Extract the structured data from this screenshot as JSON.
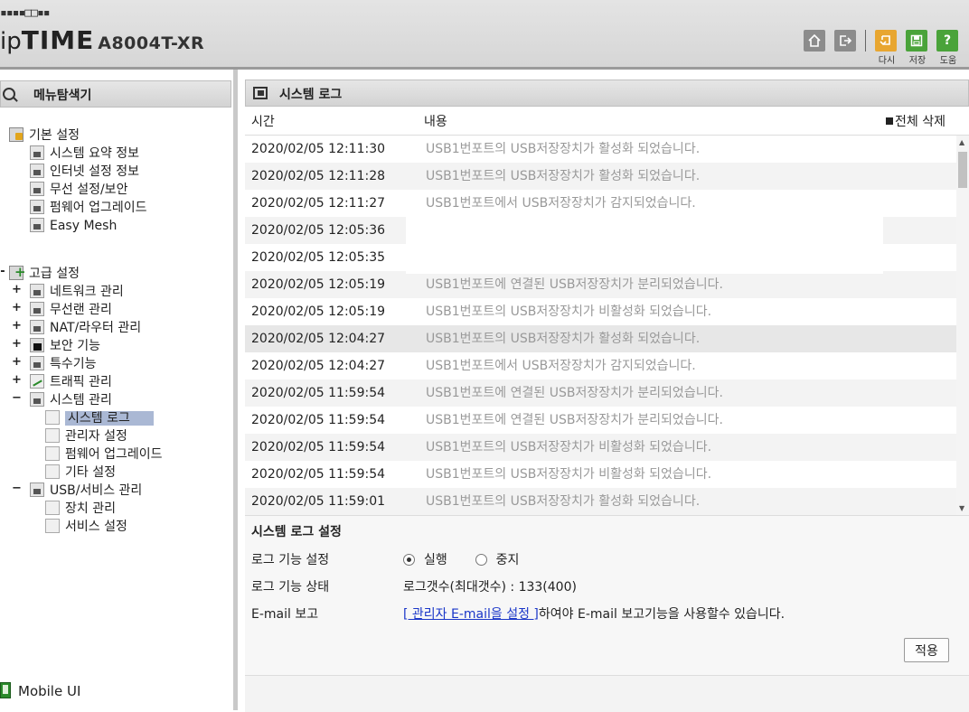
{
  "header": {
    "brand_prefix": "ip",
    "brand_main": "TIME",
    "model": "A8004T-XR",
    "squares": "▪▪▪▪□□▪▪",
    "buttons": [
      {
        "name": "home",
        "label": "",
        "icon": "house-icon",
        "color": "#8c8c8c"
      },
      {
        "name": "logout",
        "label": "",
        "icon": "logout-icon",
        "color": "#8c8c8c"
      },
      {
        "name": "redo",
        "label": "다시",
        "icon": "redo-icon",
        "color": "#e8a630"
      },
      {
        "name": "save",
        "label": "저장",
        "icon": "save-icon",
        "color": "#4aa33a"
      },
      {
        "name": "help",
        "label": "도움",
        "icon": "help-icon",
        "color": "#4aa33a"
      }
    ]
  },
  "sidebar": {
    "title": "메뉴탐색기",
    "basic": {
      "label": "기본 설정",
      "items": [
        "시스템 요약 정보",
        "인터넷 설정 정보",
        "무선 설정/보안",
        "펌웨어 업그레이드",
        "Easy Mesh"
      ]
    },
    "advanced": {
      "label": "고급 설정",
      "items": [
        {
          "label": "네트워크 관리",
          "expander": "+"
        },
        {
          "label": "무선랜 관리",
          "expander": "+"
        },
        {
          "label": "NAT/라우터 관리",
          "expander": "+"
        },
        {
          "label": "보안 기능",
          "expander": "+"
        },
        {
          "label": "특수기능",
          "expander": "+"
        },
        {
          "label": "트래픽 관리",
          "expander": "+"
        },
        {
          "label": "시스템 관리",
          "expander": "−"
        },
        {
          "label": "USB/서비스 관리",
          "expander": "−"
        }
      ],
      "system_children": [
        "시스템 로그",
        "관리자 설정",
        "펌웨어 업그레이드",
        "기타 설정"
      ],
      "usb_children": [
        "장치 관리",
        "서비스 설정"
      ]
    },
    "mobile_label": "Mobile UI",
    "advanced_expander": "-"
  },
  "main": {
    "title": "시스템 로그",
    "col_time": "시간",
    "col_content": "내용",
    "delete_all": "전체 삭제",
    "logs": [
      {
        "time": "2020/02/05 12:11:30",
        "msg": "USB1번포트의 USB저장장치가 활성화 되었습니다."
      },
      {
        "time": "2020/02/05 12:11:28",
        "msg": "USB1번포트의 USB저장장치가 활성화 되었습니다."
      },
      {
        "time": "2020/02/05 12:11:27",
        "msg": "USB1번포트에서 USB저장장치가 감지되었습니다."
      },
      {
        "time": "2020/02/05 12:05:36",
        "msg": ""
      },
      {
        "time": "2020/02/05 12:05:35",
        "msg": ""
      },
      {
        "time": "2020/02/05 12:05:19",
        "msg": "USB1번포트에 연결된 USB저장장치가 분리되었습니다."
      },
      {
        "time": "2020/02/05 12:05:19",
        "msg": "USB1번포트의 USB저장장치가 비활성화 되었습니다."
      },
      {
        "time": "2020/02/05 12:04:27",
        "msg": "USB1번포트의 USB저장장치가 활성화 되었습니다."
      },
      {
        "time": "2020/02/05 12:04:27",
        "msg": "USB1번포트에서 USB저장장치가 감지되었습니다."
      },
      {
        "time": "2020/02/05 11:59:54",
        "msg": "USB1번포트에 연결된 USB저장장치가 분리되었습니다."
      },
      {
        "time": "2020/02/05 11:59:54",
        "msg": "USB1번포트에 연결된 USB저장장치가 분리되었습니다."
      },
      {
        "time": "2020/02/05 11:59:54",
        "msg": "USB1번포트의 USB저장장치가 비활성화 되었습니다."
      },
      {
        "time": "2020/02/05 11:59:54",
        "msg": "USB1번포트의 USB저장장치가 비활성화 되었습니다."
      },
      {
        "time": "2020/02/05 11:59:01",
        "msg": "USB1번포트의 USB저장장치가 활성화 되었습니다."
      }
    ],
    "settings": {
      "title": "시스템 로그 설정",
      "log_function_label": "로그 기능 설정",
      "opt_run": "실행",
      "opt_stop": "중지",
      "selected": "실행",
      "log_status_label": "로그 기능 상태",
      "log_status_value": "로그갯수(최대갯수) : 133(400)",
      "email_label": "E-mail 보고",
      "email_link": "[ 관리자 E-mail을 설정 ]",
      "email_suffix": "하여야 E-mail 보고기능을 사용할수 있습니다.",
      "apply": "적용"
    }
  }
}
